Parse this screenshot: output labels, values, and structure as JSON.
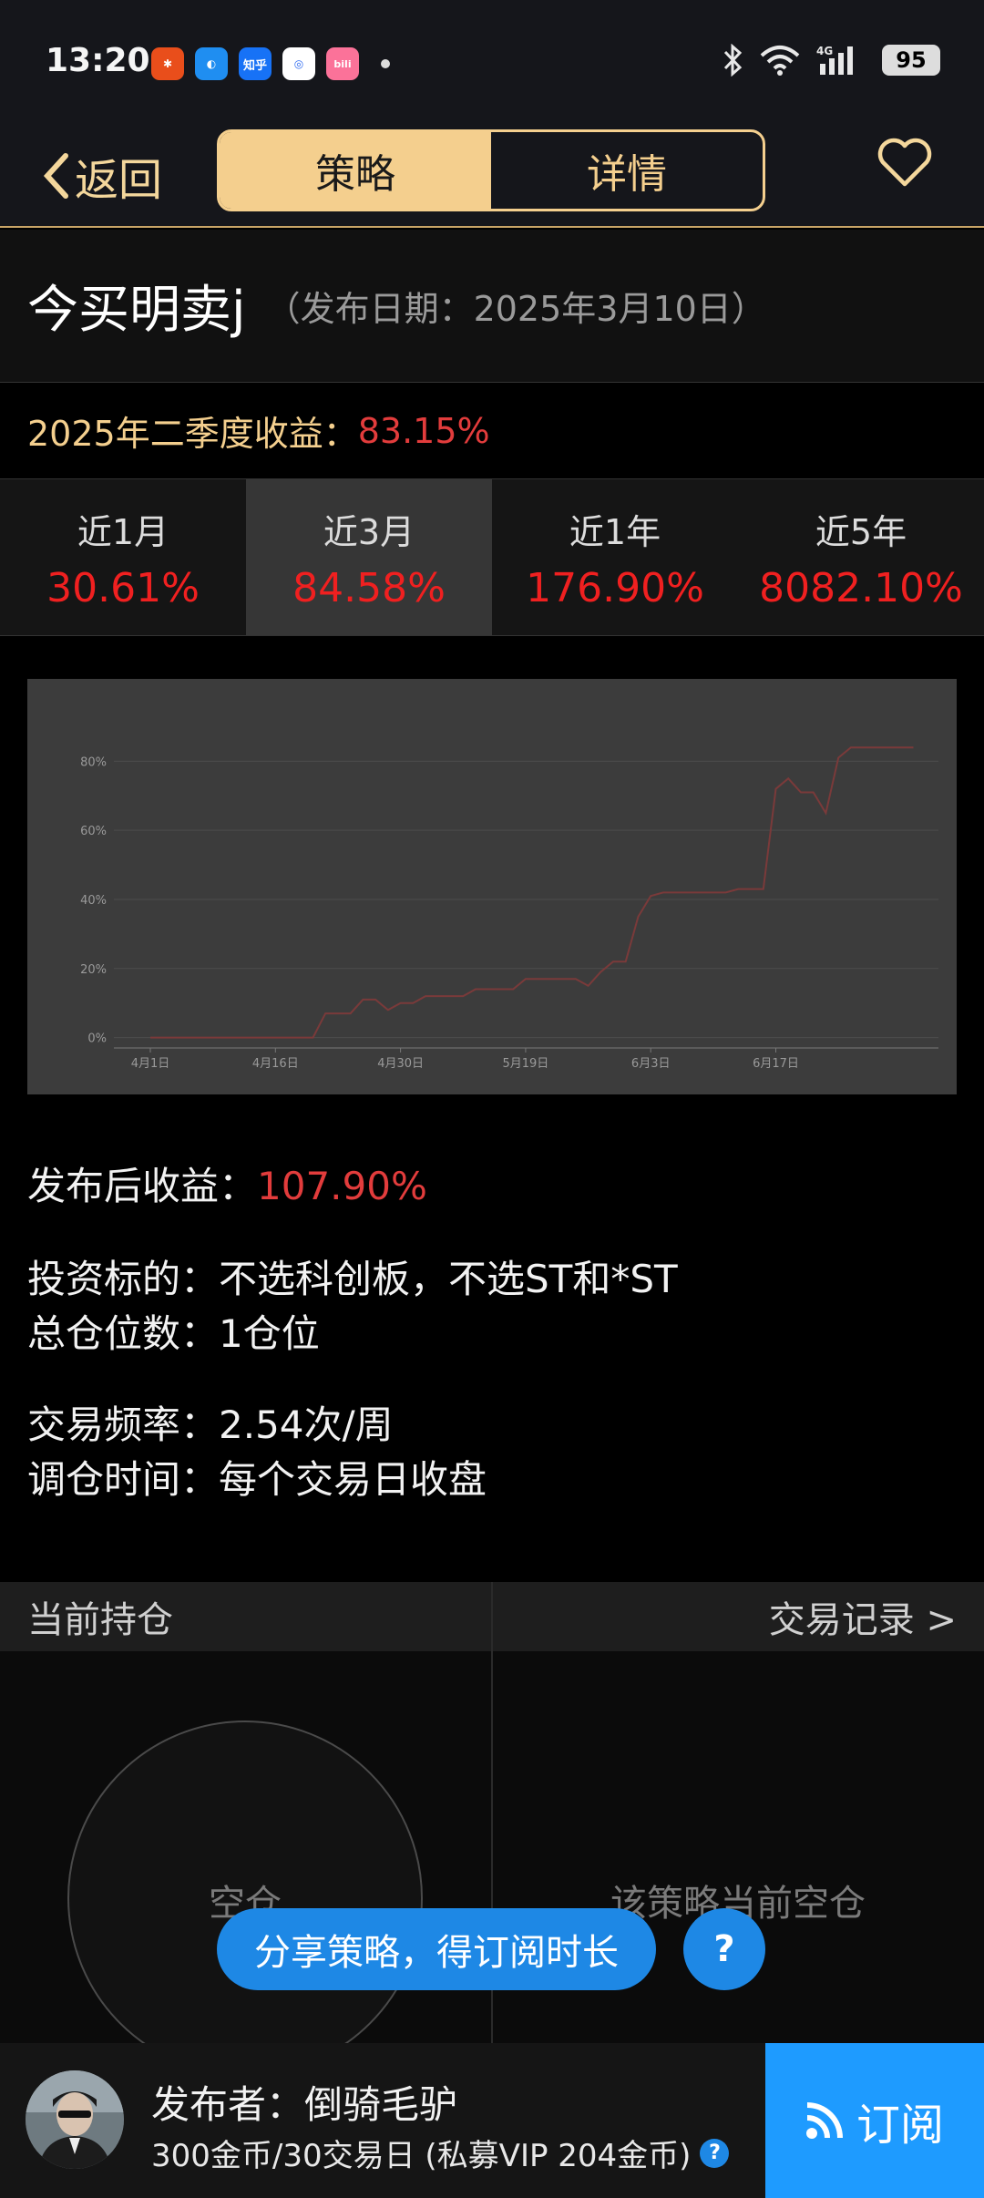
{
  "status_bar": {
    "time": "13:20",
    "battery": "95",
    "app_icons": [
      {
        "name": "weibo-icon",
        "color": "#e94e1b",
        "text": "✱"
      },
      {
        "name": "browser-icon",
        "color": "#1f8ef1",
        "text": "◐"
      },
      {
        "name": "zhihu-icon",
        "color": "#1772f6",
        "text": "知乎"
      },
      {
        "name": "baidu-icon",
        "color": "#2f6bf0",
        "text": "◎"
      },
      {
        "name": "bilibili-icon",
        "color": "#fb7299",
        "text": "bili"
      }
    ]
  },
  "nav": {
    "back_label": "返回",
    "tabs": [
      "策略",
      "详情"
    ],
    "active_tab": 0
  },
  "strategy": {
    "name": "今买明卖j",
    "publish_date": "（发布日期：2025年3月10日）"
  },
  "quarter": {
    "label": "2025年二季度收益：",
    "value": "83.15%"
  },
  "periods": [
    {
      "label": "近1月",
      "value": "30.61%"
    },
    {
      "label": "近3月",
      "value": "84.58%"
    },
    {
      "label": "近1年",
      "value": "176.90%"
    },
    {
      "label": "近5年",
      "value": "8082.10%"
    }
  ],
  "colors": {
    "accent": "#f4cf8e",
    "up_red": "#e23c3c",
    "blue": "#1e88e5",
    "line": "#7a3a3a"
  },
  "chart_data": {
    "type": "line",
    "title": "",
    "xlabel": "",
    "ylabel": "",
    "y_ticks": [
      "0%",
      "20%",
      "40%",
      "60%",
      "80%"
    ],
    "x_ticks": [
      "4月1日",
      "4月16日",
      "4月30日",
      "5月19日",
      "6月3日",
      "6月17日"
    ],
    "ylim": [
      -3,
      88
    ],
    "grid": true,
    "series": [
      {
        "x": [
          0,
          1,
          2,
          3,
          4,
          5,
          6,
          7,
          8,
          9,
          10,
          11,
          12,
          13,
          14,
          15,
          16,
          17,
          18,
          19,
          20,
          21,
          22,
          23,
          24,
          25,
          26,
          27,
          28,
          29,
          30,
          31,
          32,
          33,
          34,
          35,
          36,
          37,
          38,
          39,
          40,
          41,
          42,
          43,
          44,
          45,
          46,
          47,
          48,
          49,
          50,
          51,
          52,
          53,
          54,
          55,
          56,
          57,
          58,
          59,
          60,
          61
        ],
        "y": [
          0,
          0,
          0,
          0,
          0,
          0,
          0,
          0,
          0,
          0,
          0,
          0,
          0,
          0,
          7,
          7,
          7,
          11,
          11,
          8,
          10,
          10,
          12,
          12,
          12,
          12,
          14,
          14,
          14,
          14,
          17,
          17,
          17,
          17,
          17,
          15,
          19,
          22,
          22,
          35,
          41,
          42,
          42,
          42,
          42,
          42,
          42,
          43,
          43,
          43,
          72,
          75,
          71,
          71,
          65,
          81,
          84,
          84,
          84,
          84,
          84,
          84
        ]
      }
    ],
    "x_tick_index": [
      0,
      10,
      20,
      30,
      40,
      50
    ]
  },
  "info": {
    "post_return_label": "发布后收益：",
    "post_return_value": "107.90%",
    "target": "投资标的：不选科创板，不选ST和*ST",
    "positions": "总仓位数：1仓位",
    "frequency": "交易频率：2.54次/周",
    "rebalance": "调仓时间：每个交易日收盘"
  },
  "holdings": {
    "title": "当前持仓",
    "records_link": "交易记录 >",
    "empty_circle": "空仓",
    "empty_text": "该策略当前空仓"
  },
  "share": {
    "label": "分享策略，得订阅时长",
    "help": "?"
  },
  "footer": {
    "publisher": "发布者：倒骑毛驴",
    "price": "300金币/30交易日 (私募VIP 204金币)",
    "subscribe": "订阅"
  }
}
